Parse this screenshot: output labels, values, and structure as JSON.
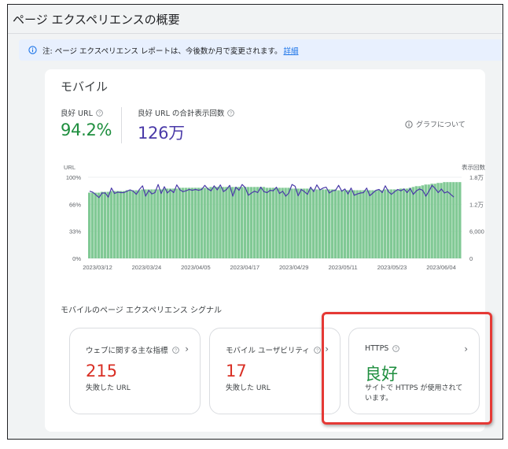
{
  "page_title": "ページ エクスペリエンスの概要",
  "notice": {
    "text": "注: ページ エクスペリエンス レポートは、今後数か月で変更されます。",
    "link": "詳細"
  },
  "card": {
    "title": "モバイル",
    "metrics": [
      {
        "label": "良好 URL",
        "value": "94.2%"
      },
      {
        "label": "良好 URL の合計表示回数",
        "value": "126万"
      }
    ],
    "about_graph": "グラフについて"
  },
  "chart_data": {
    "type": "bar",
    "left_axis_label": "URL",
    "right_axis_label": "表示回数",
    "left_ticks": [
      "100%",
      "66%",
      "33%",
      "0%"
    ],
    "right_ticks": [
      "1.8万",
      "1.2万",
      "6,000",
      "0"
    ],
    "x_ticks": [
      "2023/03/12",
      "2023/03/24",
      "2023/04/05",
      "2023/04/17",
      "2023/04/29",
      "2023/05/11",
      "2023/05/23",
      "2023/06/04"
    ],
    "bar_series": {
      "color": "#81c995",
      "values": [
        0.81,
        0.81,
        0.81,
        0.81,
        0.82,
        0.82,
        0.82,
        0.83,
        0.83,
        0.83,
        0.83,
        0.83,
        0.84,
        0.84,
        0.84,
        0.84,
        0.84,
        0.85,
        0.85,
        0.85,
        0.85,
        0.85,
        0.85,
        0.85,
        0.86,
        0.86,
        0.86,
        0.86,
        0.86,
        0.87,
        0.87,
        0.87,
        0.87,
        0.87,
        0.87,
        0.87,
        0.87,
        0.87,
        0.87,
        0.88,
        0.88,
        0.88,
        0.88,
        0.88,
        0.88,
        0.88,
        0.88,
        0.88,
        0.88,
        0.88,
        0.88,
        0.88,
        0.88,
        0.88,
        0.88,
        0.88,
        0.88,
        0.87,
        0.87,
        0.87,
        0.87,
        0.87,
        0.87,
        0.87,
        0.87,
        0.86,
        0.86,
        0.86,
        0.86,
        0.86,
        0.86,
        0.86,
        0.85,
        0.85,
        0.85,
        0.85,
        0.85,
        0.85,
        0.85,
        0.85,
        0.84,
        0.84,
        0.84,
        0.84,
        0.84,
        0.84,
        0.84,
        0.84,
        0.84,
        0.84,
        0.84,
        0.84,
        0.84,
        0.84,
        0.84,
        0.85,
        0.85,
        0.85,
        0.85,
        0.85,
        0.86,
        0.86,
        0.86,
        0.87,
        0.88,
        0.89,
        0.89,
        0.9,
        0.91,
        0.91,
        0.92,
        0.92,
        0.93,
        0.93,
        0.94,
        0.94,
        0.94,
        0.94,
        0.94,
        0.94
      ]
    },
    "line_series": {
      "color": "#4a3aa8",
      "values": [
        14900,
        14700,
        14100,
        13500,
        14500,
        14500,
        13600,
        15600,
        14400,
        14700,
        14600,
        14600,
        14900,
        15200,
        14900,
        14200,
        15300,
        16100,
        13800,
        15100,
        14300,
        14600,
        16400,
        14400,
        15900,
        14500,
        15200,
        14600,
        16300,
        15200,
        14800,
        15000,
        15300,
        15100,
        15300,
        15100,
        15300,
        16200,
        15400,
        15000,
        16100,
        15200,
        16300,
        14800,
        15300,
        16200,
        13800,
        15800,
        15100,
        16400,
        15700,
        14000,
        14500,
        14900,
        14600,
        15800,
        14800,
        14600,
        15100,
        15000,
        15800,
        14400,
        14900,
        13800,
        14500,
        16400,
        16000,
        13900,
        15300,
        14800,
        14200,
        15800,
        14800,
        16300,
        15200,
        15600,
        15800,
        14500,
        15000,
        15100,
        16200,
        14900,
        15400,
        14300,
        15600,
        14000,
        14300,
        14500,
        14600,
        15600,
        13900,
        14500,
        15100,
        15300,
        14600,
        16100,
        14800,
        14200,
        14800,
        15300,
        15000,
        15400,
        14600,
        15500,
        14200,
        15000,
        15400,
        15100,
        13800,
        14900,
        16200,
        15500,
        14600,
        15400,
        14500,
        14800,
        14200,
        13600
      ]
    }
  },
  "section_title": "モバイルのページ エクスペリエンス シグナル",
  "tiles": [
    {
      "title": "ウェブに関する主な指標",
      "value": "215",
      "sub": "失敗した URL"
    },
    {
      "title": "モバイル ユーザビリティ",
      "value": "17",
      "sub": "失敗した URL"
    },
    {
      "title": "HTTPS",
      "value": "良好",
      "sub": "サイトで HTTPS が使用されています。"
    }
  ]
}
